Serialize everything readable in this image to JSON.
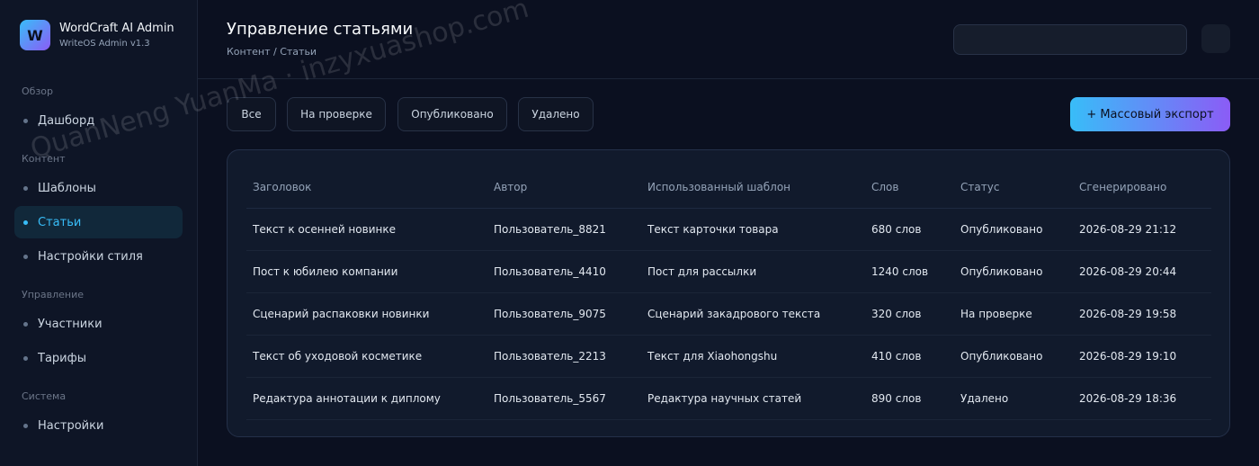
{
  "brand": {
    "logo_letter": "W",
    "name": "WordCraft AI Admin",
    "version": "WriteOS Admin v1.3"
  },
  "sidebar": {
    "sections": [
      {
        "label": "Обзор"
      },
      {
        "label": "Контент"
      },
      {
        "label": "Управление"
      },
      {
        "label": "Система"
      }
    ],
    "items": [
      {
        "label": "Дашборд",
        "active": false
      },
      {
        "label": "Шаблоны",
        "active": false
      },
      {
        "label": "Статьи",
        "active": true
      },
      {
        "label": "Настройки стиля",
        "active": false
      },
      {
        "label": "Участники",
        "active": false
      },
      {
        "label": "Тарифы",
        "active": false
      },
      {
        "label": "Настройки",
        "active": false
      }
    ]
  },
  "header": {
    "title": "Управление статьями",
    "breadcrumb": "Контент / Статьи"
  },
  "filters": [
    {
      "label": "Все"
    },
    {
      "label": "На проверке"
    },
    {
      "label": "Опубликовано"
    },
    {
      "label": "Удалено"
    }
  ],
  "export_label": "+ Массовый экспорт",
  "table": {
    "columns": [
      "Заголовок",
      "Автор",
      "Использованный шаблон",
      "Слов",
      "Статус",
      "Сгенерировано"
    ],
    "rows": [
      {
        "title": "Текст к осенней новинке",
        "author": "Пользователь_8821",
        "template": "Текст карточки товара",
        "words": "680 слов",
        "status": "Опубликовано",
        "status_kind": "published",
        "generated": "2026-08-29 21:12"
      },
      {
        "title": "Пост к юбилею компании",
        "author": "Пользователь_4410",
        "template": "Пост для рассылки",
        "words": "1240 слов",
        "status": "Опубликовано",
        "status_kind": "published",
        "generated": "2026-08-29 20:44"
      },
      {
        "title": "Сценарий распаковки новинки",
        "author": "Пользователь_9075",
        "template": "Сценарий закадрового текста",
        "words": "320 слов",
        "status": "На проверке",
        "status_kind": "review",
        "generated": "2026-08-29 19:58"
      },
      {
        "title": "Текст об уходовой косметике",
        "author": "Пользователь_2213",
        "template": "Текст для Xiaohongshu",
        "words": "410 слов",
        "status": "Опубликовано",
        "status_kind": "published",
        "generated": "2026-08-29 19:10"
      },
      {
        "title": "Редактура аннотации к диплому",
        "author": "Пользователь_5567",
        "template": "Редактура научных статей",
        "words": "890 слов",
        "status": "Удалено",
        "status_kind": "deleted",
        "generated": "2026-08-29 18:36"
      }
    ]
  },
  "watermark": "QuanNeng YuanMa · inzyxuashop.com",
  "colors": {
    "accent": "#38bdf8",
    "accent2": "#8b5cf6",
    "published": "#34d399",
    "review": "#fbbf24",
    "deleted": "#94a3b8"
  }
}
